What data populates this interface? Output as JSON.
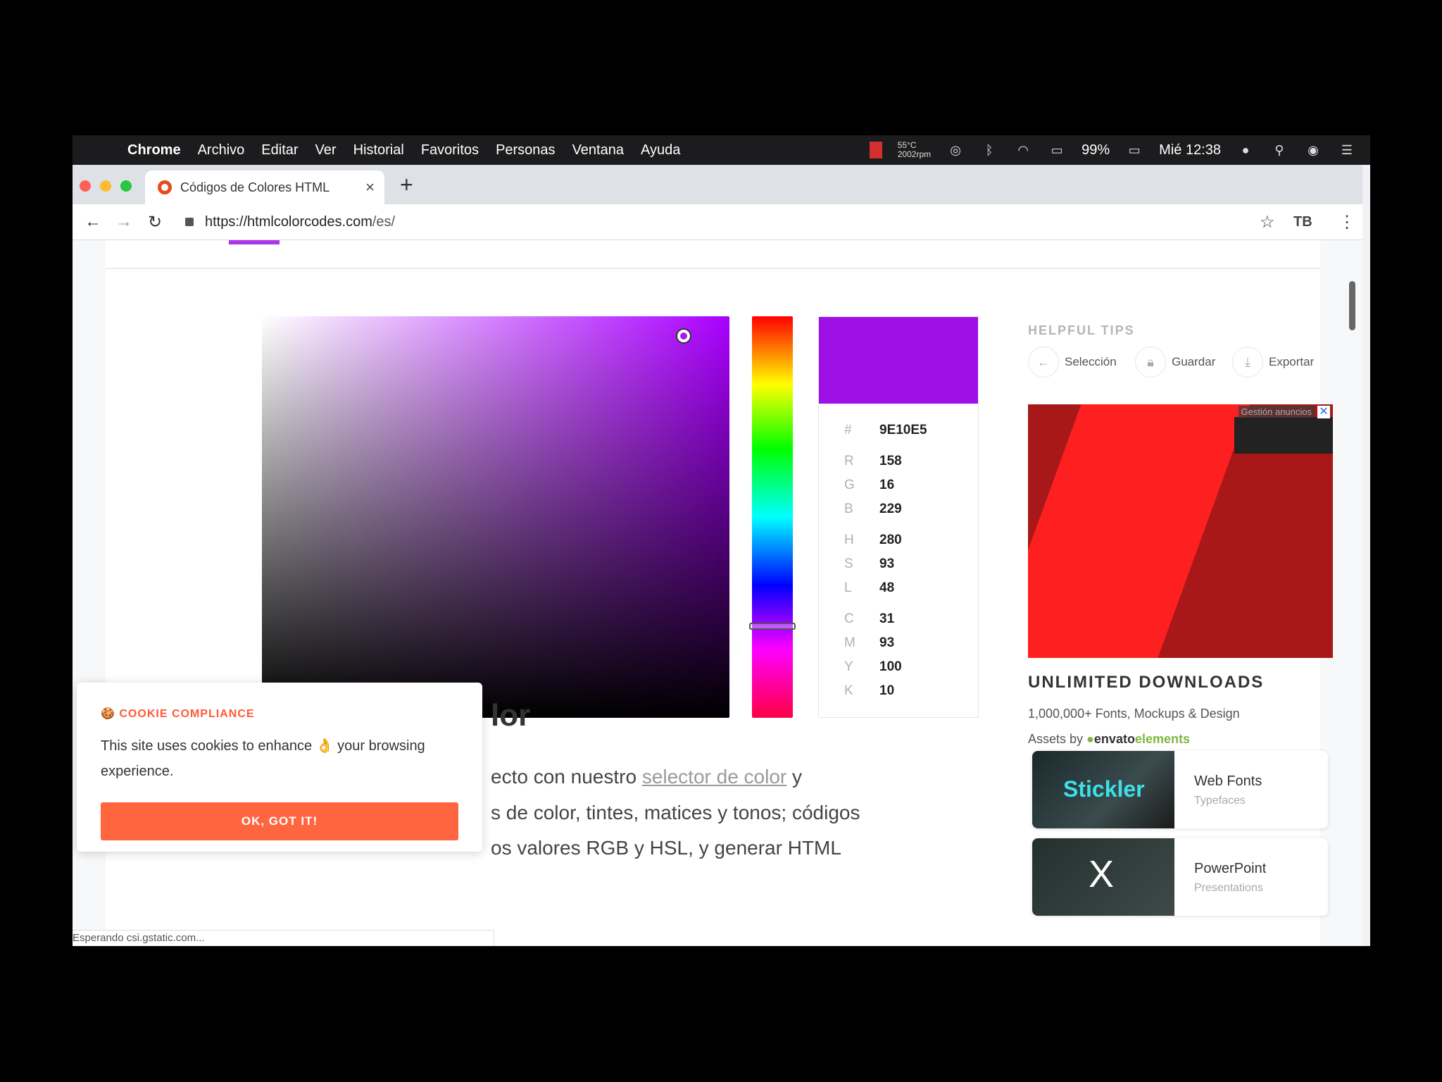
{
  "menubar": {
    "app": "Chrome",
    "menus": [
      "Archivo",
      "Editar",
      "Ver",
      "Historial",
      "Favoritos",
      "Personas",
      "Ventana",
      "Ayuda"
    ],
    "temp": "55°C",
    "fan": "2002rpm",
    "battery": "99%",
    "clock": "Mié 12:38"
  },
  "browser": {
    "tab_title": "Códigos de Colores HTML",
    "url_host": "https://htmlcolorcodes.com",
    "url_path": "/es/"
  },
  "picker": {
    "color": "#9e10e5",
    "hex_label": "#",
    "hex": "9E10E5",
    "rgb": [
      {
        "k": "R",
        "v": "158"
      },
      {
        "k": "G",
        "v": "16"
      },
      {
        "k": "B",
        "v": "229"
      }
    ],
    "hsl": [
      {
        "k": "H",
        "v": "280"
      },
      {
        "k": "S",
        "v": "93"
      },
      {
        "k": "L",
        "v": "48"
      }
    ],
    "cmyk": [
      {
        "k": "C",
        "v": "31"
      },
      {
        "k": "M",
        "v": "93"
      },
      {
        "k": "Y",
        "v": "100"
      },
      {
        "k": "K",
        "v": "10"
      }
    ]
  },
  "tips": {
    "title": "HELPFUL TIPS",
    "selection": "Selección",
    "save": "Guardar",
    "export": "Exportar"
  },
  "ad": {
    "label": "Gestión anuncios",
    "close": "✕"
  },
  "promo": {
    "title": "UNLIMITED DOWNLOADS",
    "line1": "1,000,000+ Fonts, Mockups & Design",
    "assets_by": "Assets by",
    "envato": "envato",
    "elements": "elements",
    "cards": [
      {
        "thumb": "Stickler",
        "title": "Web Fonts",
        "sub": "Typefaces"
      },
      {
        "thumb": "X",
        "title": "PowerPoint",
        "sub": "Presentations"
      }
    ]
  },
  "content": {
    "heading": "lor",
    "line1_pre": "ecto con nuestro ",
    "line1_link": "selector de color",
    "line1_post": " y",
    "line2": "s de color, tintes, matices y tonos; códigos",
    "line3": "os valores RGB y HSL, y generar HTML"
  },
  "cookie": {
    "title": "COOKIE COMPLIANCE",
    "message": "This site uses cookies to enhance 👌 your browsing experience.",
    "button": "OK, GOT IT!"
  },
  "status": "Esperando csi.gstatic.com..."
}
